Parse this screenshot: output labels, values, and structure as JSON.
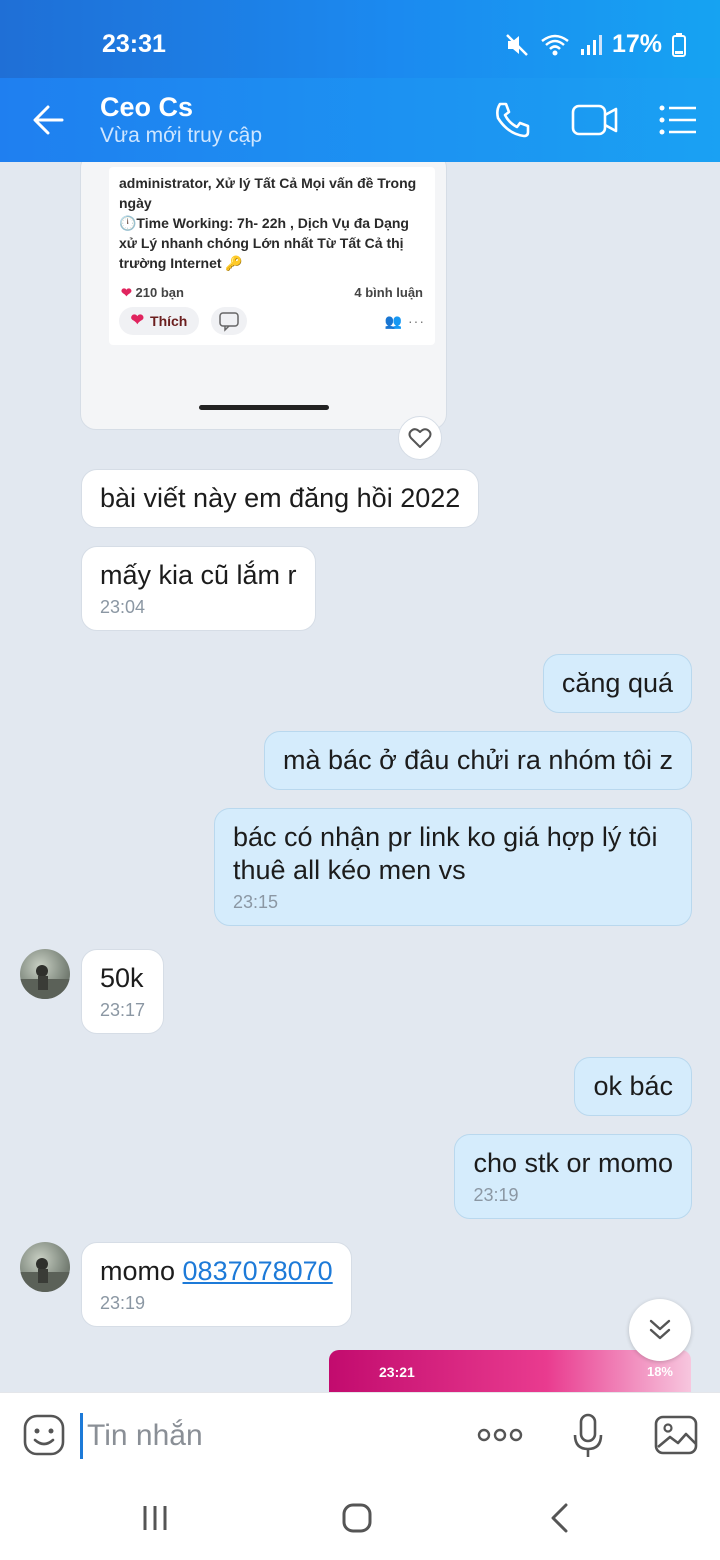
{
  "status_bar": {
    "time": "23:31",
    "battery": "17%"
  },
  "header": {
    "title": "Ceo Cs",
    "subtitle": "Vừa mới truy cập"
  },
  "shared_screenshot": {
    "post_text": "administrator, Xử lý Tất Cả Mọi vấn đề Trong ngày\n🕛Time Working: 7h- 22h , Dịch Vụ đa Dạng xử Lý nhanh chóng Lớn nhất Từ Tất Cả thị trường Internet 🔑",
    "likes": "210 bạn",
    "comments": "4 bình luận",
    "like_button": "Thích"
  },
  "messages": [
    {
      "text": "bài viết này em đăng hồi 2022",
      "time": ""
    },
    {
      "text": "mấy kia cũ lắm r",
      "time": "23:04"
    },
    {
      "text": "căng quá",
      "time": ""
    },
    {
      "text": "mà bác ở đâu chửi ra nhóm tôi z",
      "time": ""
    },
    {
      "text": "bác có nhận pr link ko giá hợp lý tôi thuê all kéo men vs",
      "time": "23:15"
    },
    {
      "text": "50k",
      "time": "23:17"
    },
    {
      "text": "ok bác",
      "time": ""
    },
    {
      "text": "cho stk or momo",
      "time": "23:19"
    },
    {
      "text": "momo ",
      "link": "0837078070",
      "time": "23:19"
    }
  ],
  "pink_screenshot": {
    "time": "23:21",
    "status": "18%"
  },
  "input": {
    "placeholder": "Tin nhắn"
  },
  "colors": {
    "header_blue": "#1a8ff2",
    "sent_bubble": "#d5ecfc",
    "received_bubble": "#ffffff",
    "chat_background": "#e2e8f0",
    "link": "#1d7ad8"
  }
}
